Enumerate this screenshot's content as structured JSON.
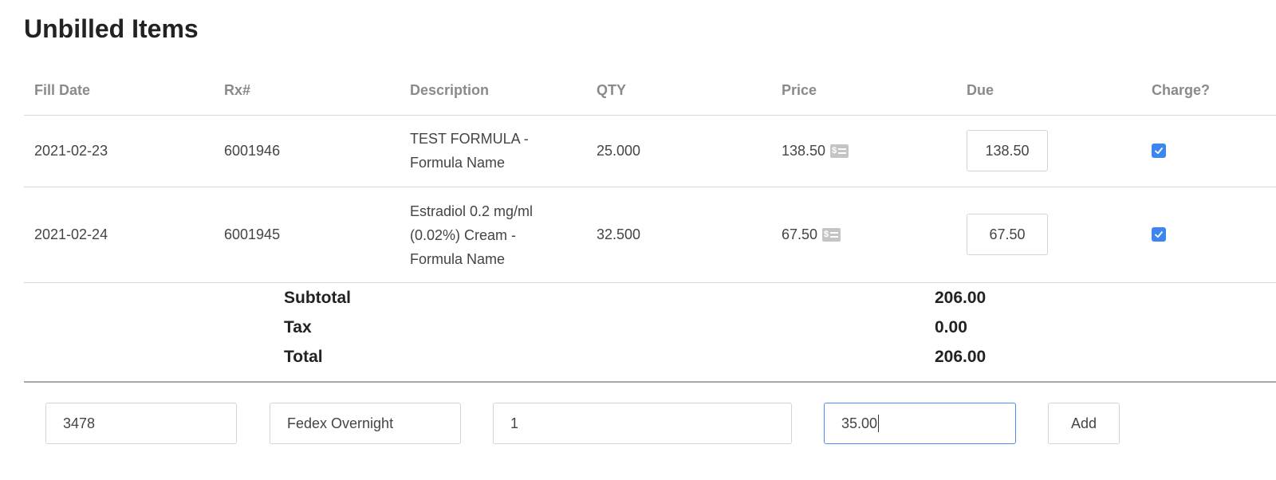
{
  "page": {
    "title": "Unbilled Items"
  },
  "table": {
    "columns": [
      "Fill Date",
      "Rx#",
      "Description",
      "QTY",
      "Price",
      "Due",
      "Charge?"
    ],
    "rows": [
      {
        "fill_date": "2021-02-23",
        "rx": "6001946",
        "description_lines": [
          "TEST FORMULA -",
          "Formula Name"
        ],
        "qty": "25.000",
        "price": "138.50",
        "due": "138.50",
        "charge": true
      },
      {
        "fill_date": "2021-02-24",
        "rx": "6001945",
        "description_lines": [
          "Estradiol 0.2 mg/ml",
          "(0.02%) Cream -",
          "Formula Name"
        ],
        "qty": "32.500",
        "price": "67.50",
        "due": "67.50",
        "charge": true
      }
    ],
    "price_icon": "payment-card-icon",
    "check_color": "#3d86f0"
  },
  "totals": {
    "subtotal_label": "Subtotal",
    "subtotal_value": "206.00",
    "tax_label": "Tax",
    "tax_value": "0.00",
    "total_label": "Total",
    "total_value": "206.00"
  },
  "add_form": {
    "field1_value": "3478",
    "field2_value": "Fedex Overnight",
    "field3_value": "1",
    "field4_value": "35.00",
    "add_label": "Add",
    "focus_color": "#4a8df5"
  }
}
